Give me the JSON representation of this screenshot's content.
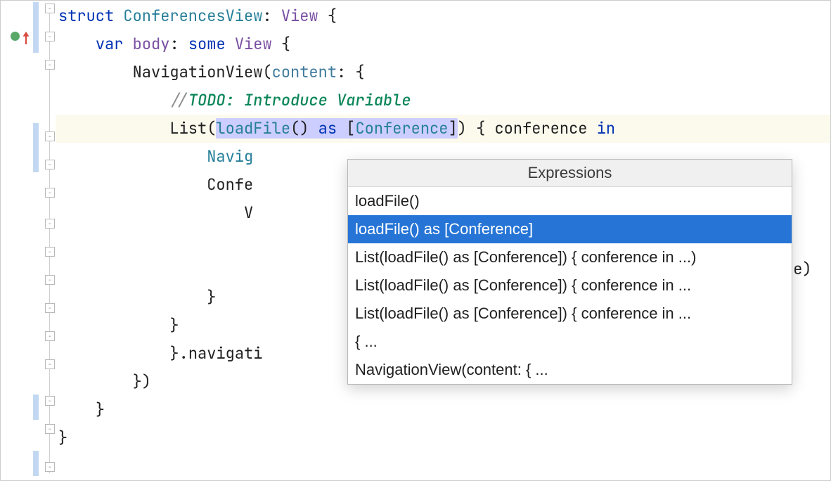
{
  "code": {
    "line1": {
      "struct": "struct",
      "name": "ConferencesView",
      "colon": ":",
      "view": "View",
      "brace": "{"
    },
    "line2": {
      "var": "var",
      "body": "body",
      "colon": ":",
      "some": "some",
      "view": "View",
      "brace": "{"
    },
    "line3": {
      "nav": "NavigationView",
      "open": "(",
      "content": "content",
      "colon": ":",
      "brace": " {"
    },
    "line4": {
      "slashes": "//",
      "todo": "TODO: Introduce Variable"
    },
    "line5": {
      "list": "List",
      "open": "(",
      "sel_loadfile": "loadFile",
      "sel_parens": "()",
      "sel_as": " as ",
      "sel_bracket_open": "[",
      "sel_conf": "Conference",
      "sel_bracket_close": "]",
      "close": ")",
      "brace": " {",
      "conf": " conference ",
      "in": "in"
    },
    "line6": {
      "navig": "Navig"
    },
    "line7": {
      "confe": "Confe"
    },
    "line8": {
      "v": "V"
    },
    "line9": {
      "text": ""
    },
    "line10": {
      "behind": "eadline)"
    },
    "line11": {
      "brace": "}"
    },
    "line12": {
      "brace": "}"
    },
    "line13": {
      "brace": "}",
      "dot": ".",
      "navcall": "navigati"
    },
    "line14": {
      "close": "})"
    },
    "line15": {
      "brace": "}"
    },
    "line16": {
      "brace": "}"
    }
  },
  "popup": {
    "title": "Expressions",
    "items": [
      "loadFile()",
      "loadFile() as [Conference]",
      "List(loadFile() as [Conference]) { conference in ...)",
      "List(loadFile() as [Conference]) { conference in ...",
      "List(loadFile() as [Conference]) { conference in ...",
      "{ ...",
      "NavigationView(content: { ..."
    ],
    "selected_index": 1
  }
}
